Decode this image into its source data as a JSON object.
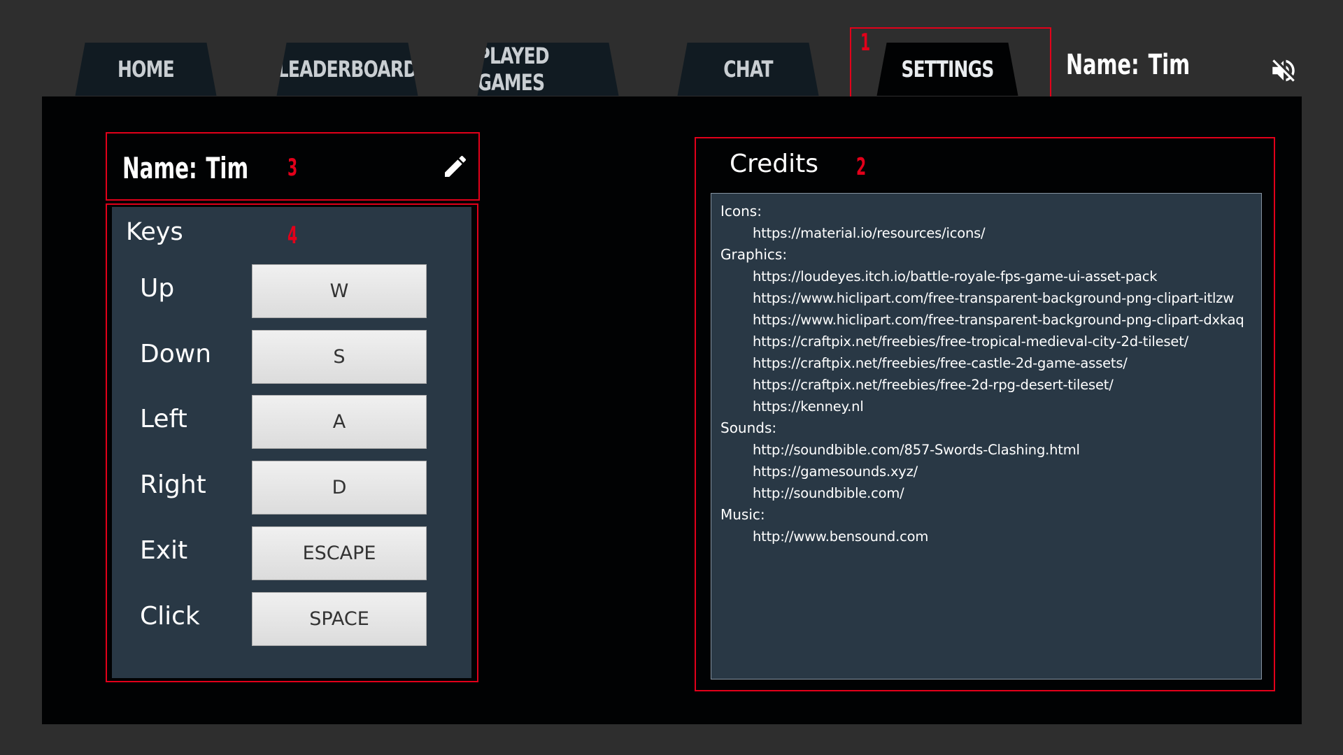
{
  "nav": {
    "tabs": [
      {
        "label": "HOME"
      },
      {
        "label": "LEADERBOARD"
      },
      {
        "label": "PLAYED GAMES"
      },
      {
        "label": "CHAT"
      },
      {
        "label": "SETTINGS",
        "active": true
      }
    ],
    "user": {
      "name_label": "Name:",
      "name_value": "Tim"
    },
    "mute_icon": "volume-off-icon"
  },
  "profile": {
    "name_label": "Name:",
    "name_value": "Tim",
    "edit_icon": "pencil-icon"
  },
  "keys": {
    "title": "Keys",
    "bindings": [
      {
        "action": "Up",
        "key": "W"
      },
      {
        "action": "Down",
        "key": "S"
      },
      {
        "action": "Left",
        "key": "A"
      },
      {
        "action": "Right",
        "key": "D"
      },
      {
        "action": "Exit",
        "key": "ESCAPE"
      },
      {
        "action": "Click",
        "key": "SPACE"
      }
    ]
  },
  "credits": {
    "title": "Credits",
    "sections": [
      {
        "heading": "Icons:",
        "links": [
          "https://material.io/resources/icons/"
        ]
      },
      {
        "heading": "Graphics:",
        "links": [
          "https://loudeyes.itch.io/battle-royale-fps-game-ui-asset-pack",
          "https://www.hiclipart.com/free-transparent-background-png-clipart-itlzw",
          "https://www.hiclipart.com/free-transparent-background-png-clipart-dxkaq",
          "https://craftpix.net/freebies/free-tropical-medieval-city-2d-tileset/",
          "https://craftpix.net/freebies/free-castle-2d-game-assets/",
          "https://craftpix.net/freebies/free-2d-rpg-desert-tileset/",
          "https://kenney.nl"
        ]
      },
      {
        "heading": "Sounds:",
        "links": [
          "http://soundbible.com/857-Swords-Clashing.html",
          "https://gamesounds.xyz/",
          "http://soundbible.com/"
        ]
      },
      {
        "heading": "Music:",
        "links": [
          "http://www.bensound.com"
        ]
      }
    ]
  },
  "annotations": {
    "settings_tab": "1",
    "credits": "2",
    "name_bar": "3",
    "keys": "4",
    "color": "#e2001a"
  },
  "colors": {
    "page_bg": "#2e2e2e",
    "panel_bg": "#010203",
    "tab_bg": "#111b22",
    "card_bg": "#293845"
  }
}
